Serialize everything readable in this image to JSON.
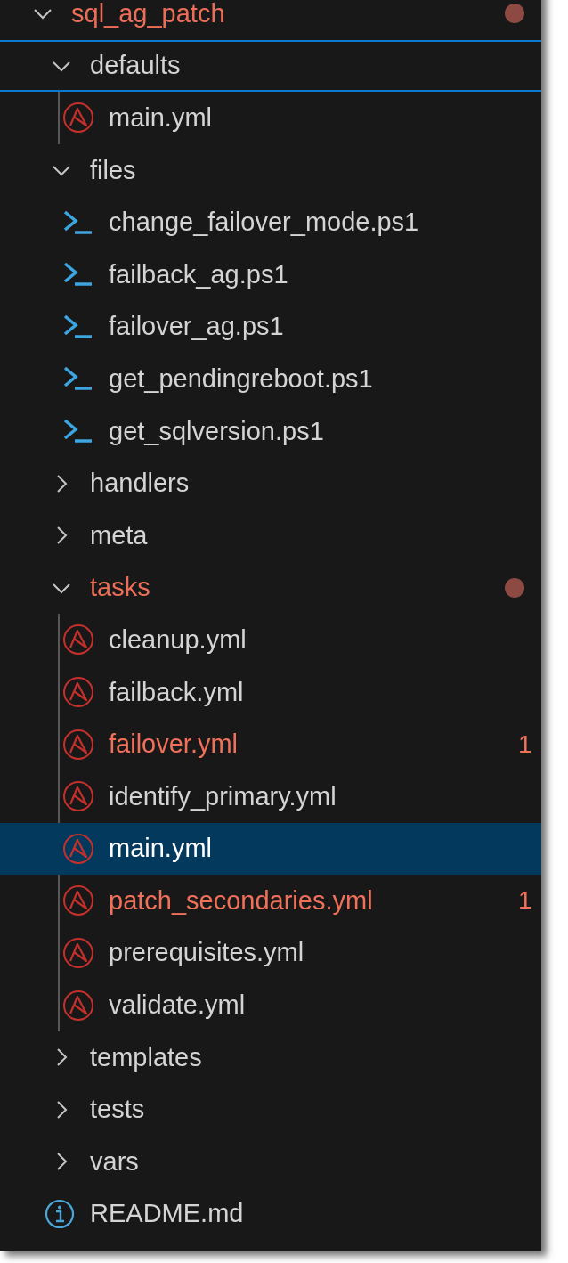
{
  "explorer": {
    "tree": [
      {
        "name": "sql_ag_patch",
        "kind": "folder",
        "expanded": true,
        "selected": false,
        "focused": false,
        "modified": true,
        "children": [
          {
            "name": "defaults",
            "kind": "folder",
            "expanded": true,
            "selected": false,
            "focused": true,
            "modified": false,
            "children": [
              {
                "name": "main.yml",
                "kind": "ansible",
                "selected": false,
                "focused": false,
                "modified": false
              }
            ]
          },
          {
            "name": "files",
            "kind": "folder",
            "expanded": true,
            "selected": false,
            "focused": false,
            "modified": false,
            "children": [
              {
                "name": "change_failover_mode.ps1",
                "kind": "powershell",
                "selected": false,
                "focused": false,
                "modified": false
              },
              {
                "name": "failback_ag.ps1",
                "kind": "powershell",
                "selected": false,
                "focused": false,
                "modified": false
              },
              {
                "name": "failover_ag.ps1",
                "kind": "powershell",
                "selected": false,
                "focused": false,
                "modified": false
              },
              {
                "name": "get_pendingreboot.ps1",
                "kind": "powershell",
                "selected": false,
                "focused": false,
                "modified": false
              },
              {
                "name": "get_sqlversion.ps1",
                "kind": "powershell",
                "selected": false,
                "focused": false,
                "modified": false
              }
            ]
          },
          {
            "name": "handlers",
            "kind": "folder",
            "expanded": false,
            "selected": false,
            "focused": false,
            "modified": false
          },
          {
            "name": "meta",
            "kind": "folder",
            "expanded": false,
            "selected": false,
            "focused": false,
            "modified": false
          },
          {
            "name": "tasks",
            "kind": "folder",
            "expanded": true,
            "selected": false,
            "focused": false,
            "modified": true,
            "children": [
              {
                "name": "cleanup.yml",
                "kind": "ansible",
                "selected": false,
                "focused": false,
                "modified": false
              },
              {
                "name": "failback.yml",
                "kind": "ansible",
                "selected": false,
                "focused": false,
                "modified": false
              },
              {
                "name": "failover.yml",
                "kind": "ansible",
                "selected": false,
                "focused": false,
                "modified": false,
                "problems": "1"
              },
              {
                "name": "identify_primary.yml",
                "kind": "ansible",
                "selected": false,
                "focused": false,
                "modified": false
              },
              {
                "name": "main.yml",
                "kind": "ansible",
                "selected": true,
                "focused": false,
                "modified": false
              },
              {
                "name": "patch_secondaries.yml",
                "kind": "ansible",
                "selected": false,
                "focused": false,
                "modified": false,
                "problems": "1"
              },
              {
                "name": "prerequisites.yml",
                "kind": "ansible",
                "selected": false,
                "focused": false,
                "modified": false
              },
              {
                "name": "validate.yml",
                "kind": "ansible",
                "selected": false,
                "focused": false,
                "modified": false
              }
            ]
          },
          {
            "name": "templates",
            "kind": "folder",
            "expanded": false,
            "selected": false,
            "focused": false,
            "modified": false
          },
          {
            "name": "tests",
            "kind": "folder",
            "expanded": false,
            "selected": false,
            "focused": false,
            "modified": false
          },
          {
            "name": "vars",
            "kind": "folder",
            "expanded": false,
            "selected": false,
            "focused": false,
            "modified": false
          },
          {
            "name": "README.md",
            "kind": "info",
            "selected": false,
            "focused": false,
            "modified": false
          }
        ]
      }
    ]
  }
}
